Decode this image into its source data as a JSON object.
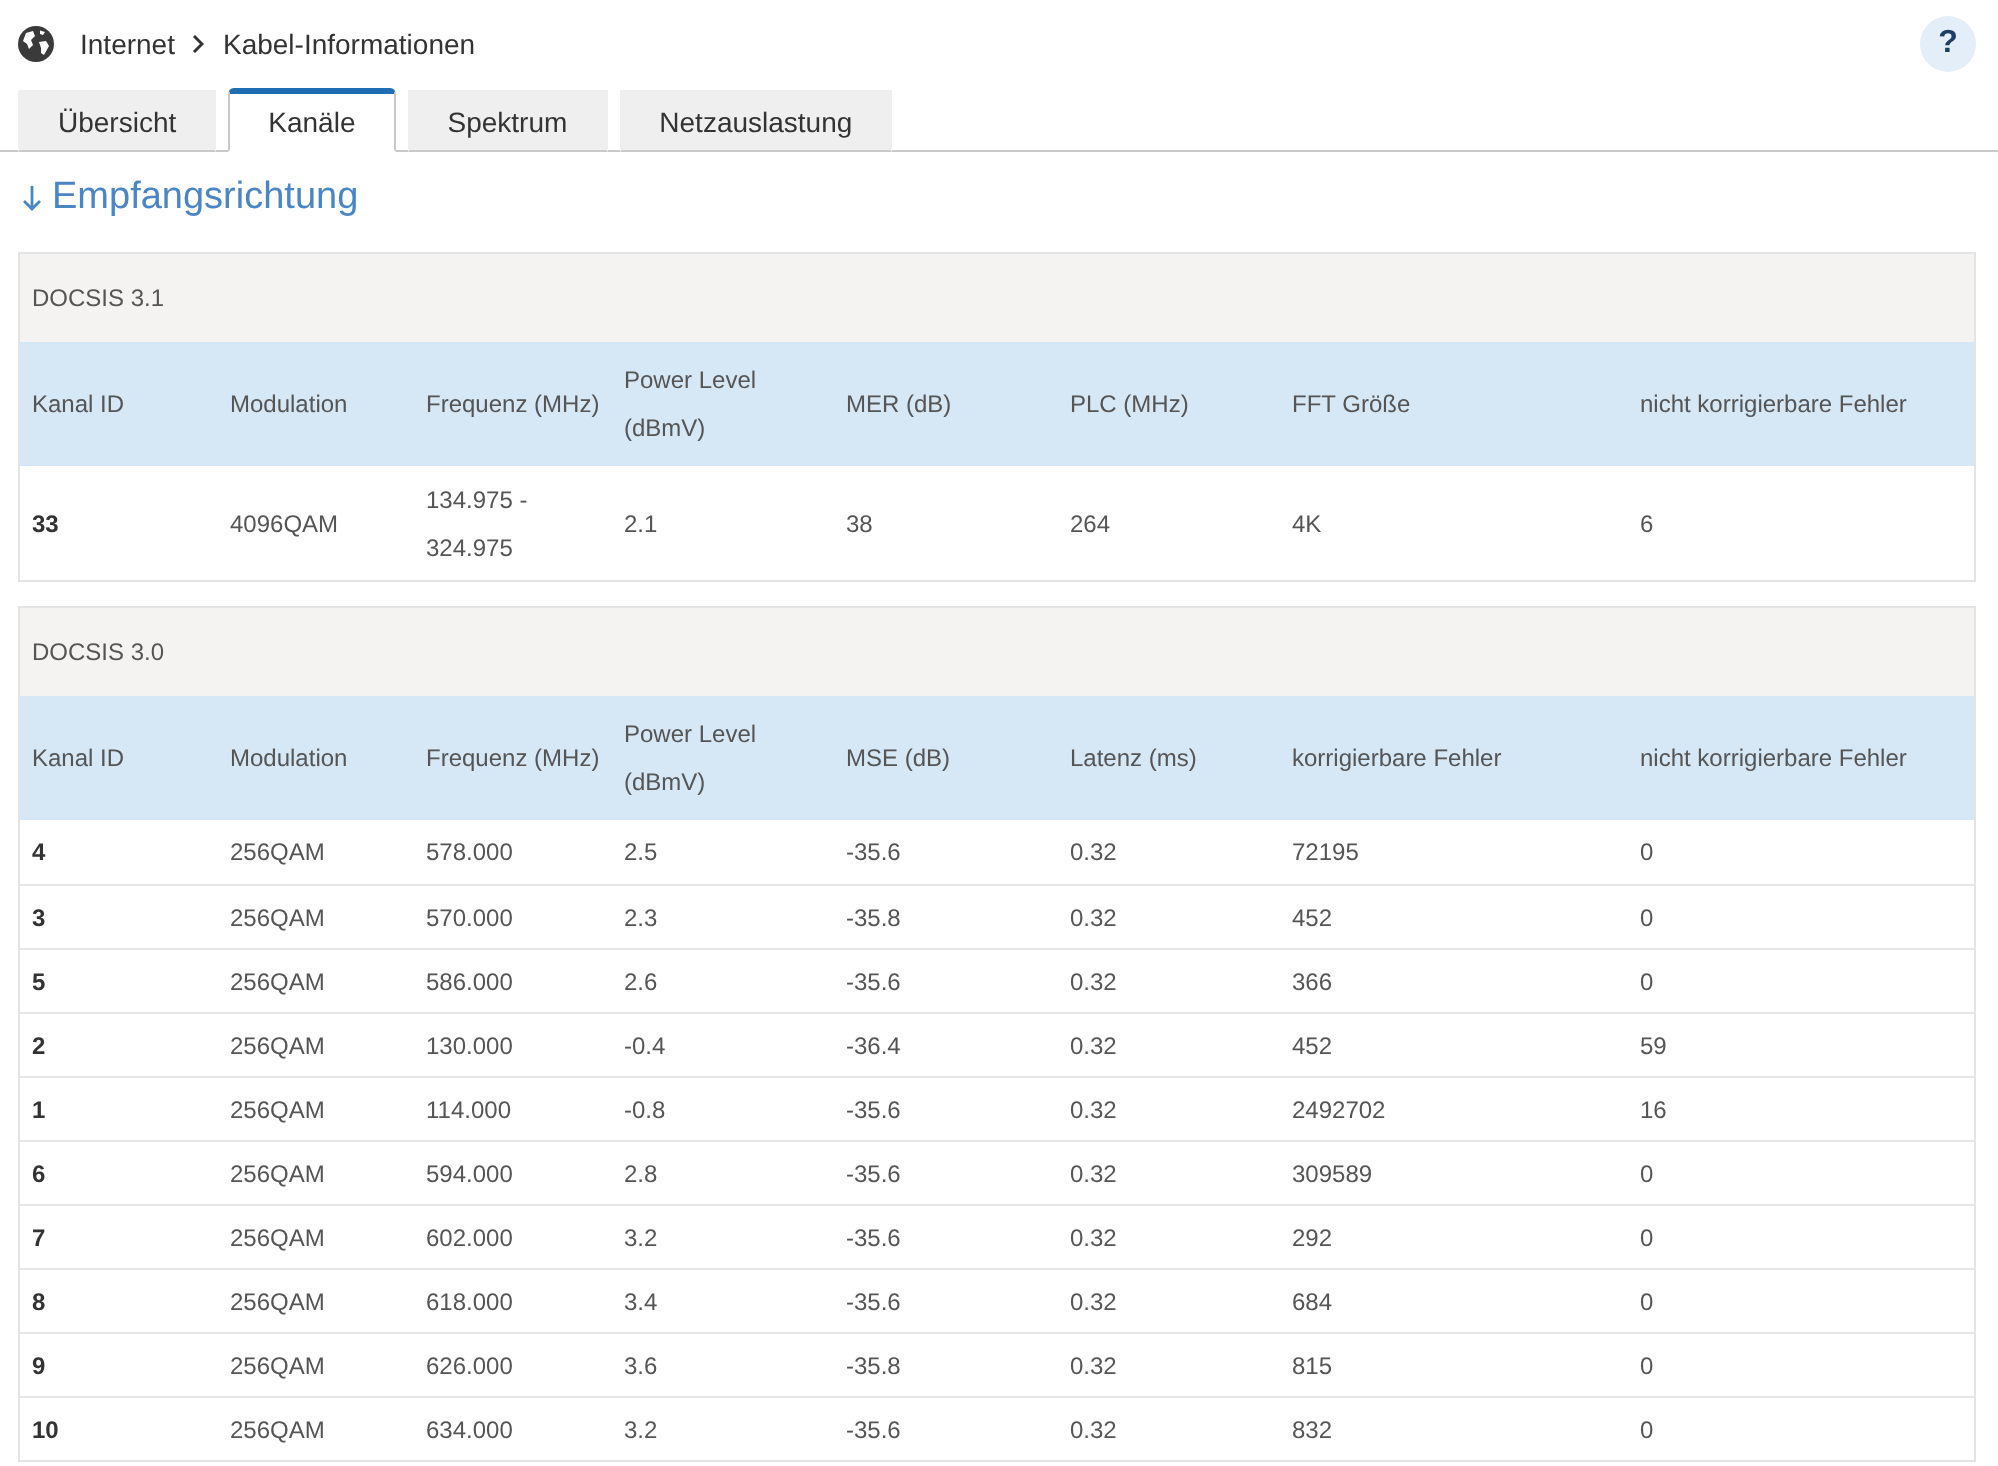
{
  "breadcrumb": {
    "items": [
      "Internet",
      "Kabel-Informationen"
    ]
  },
  "help_button": {
    "label": "?"
  },
  "tabs": [
    {
      "label": "Übersicht",
      "selected": false
    },
    {
      "label": "Kanäle",
      "selected": true
    },
    {
      "label": "Spektrum",
      "selected": false
    },
    {
      "label": "Netzauslastung",
      "selected": false
    }
  ],
  "section": {
    "heading": "Empfangsrichtung"
  },
  "tables": [
    {
      "caption": "DOCSIS 3.1",
      "columns": [
        "Kanal ID",
        "Modulation",
        "Frequenz (MHz)",
        "Power Level (dBmV)",
        "MER (dB)",
        "PLC (MHz)",
        "FFT Größe",
        "nicht korrigierbare Fehler"
      ],
      "rows": [
        [
          "33",
          "4096QAM",
          "134.975 - 324.975",
          "2.1",
          "38",
          "264",
          "4K",
          "6"
        ]
      ]
    },
    {
      "caption": "DOCSIS 3.0",
      "columns": [
        "Kanal ID",
        "Modulation",
        "Frequenz (MHz)",
        "Power Level (dBmV)",
        "MSE (dB)",
        "Latenz (ms)",
        "korrigierbare Fehler",
        "nicht korrigierbare Fehler"
      ],
      "rows": [
        [
          "4",
          "256QAM",
          "578.000",
          "2.5",
          "-35.6",
          "0.32",
          "72195",
          "0"
        ],
        [
          "3",
          "256QAM",
          "570.000",
          "2.3",
          "-35.8",
          "0.32",
          "452",
          "0"
        ],
        [
          "5",
          "256QAM",
          "586.000",
          "2.6",
          "-35.6",
          "0.32",
          "366",
          "0"
        ],
        [
          "2",
          "256QAM",
          "130.000",
          "-0.4",
          "-36.4",
          "0.32",
          "452",
          "59"
        ],
        [
          "1",
          "256QAM",
          "114.000",
          "-0.8",
          "-35.6",
          "0.32",
          "2492702",
          "16"
        ],
        [
          "6",
          "256QAM",
          "594.000",
          "2.8",
          "-35.6",
          "0.32",
          "309589",
          "0"
        ],
        [
          "7",
          "256QAM",
          "602.000",
          "3.2",
          "-35.6",
          "0.32",
          "292",
          "0"
        ],
        [
          "8",
          "256QAM",
          "618.000",
          "3.4",
          "-35.6",
          "0.32",
          "684",
          "0"
        ],
        [
          "9",
          "256QAM",
          "626.000",
          "3.6",
          "-35.8",
          "0.32",
          "815",
          "0"
        ],
        [
          "10",
          "256QAM",
          "634.000",
          "3.2",
          "-35.6",
          "0.32",
          "832",
          "0"
        ]
      ]
    }
  ]
}
